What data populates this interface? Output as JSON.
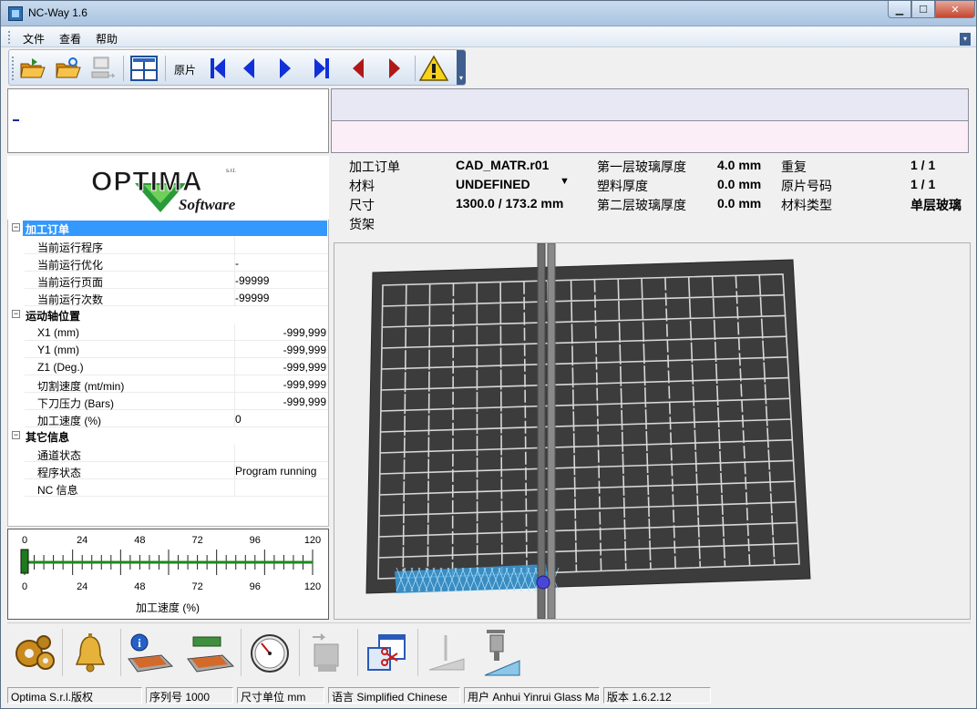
{
  "window": {
    "title": "NC-Way 1.6",
    "min_glyph": "▁",
    "max_glyph": "☐",
    "close_glyph": "✕"
  },
  "menu": {
    "items": [
      "文件",
      "查看",
      "帮助"
    ]
  },
  "toolbar": {
    "label": "原片",
    "buttons": [
      {
        "name": "open-folder-icon",
        "color": "#e8a51c"
      },
      {
        "name": "open-folder-refresh-icon",
        "color": "#e8a51c"
      },
      {
        "name": "computer-send-icon",
        "color": "#b0b0b0"
      },
      {
        "name": "grid-view-icon",
        "color": "#1f4e9c"
      },
      {
        "name": "first-icon",
        "color": "#1030d8"
      },
      {
        "name": "previous-icon",
        "color": "#1030d8"
      },
      {
        "name": "next-icon",
        "color": "#1030d8"
      },
      {
        "name": "last-icon",
        "color": "#1030d8"
      },
      {
        "name": "back-red-icon",
        "color": "#b01818"
      },
      {
        "name": "forward-red-icon",
        "color": "#b01818"
      },
      {
        "name": "warning-icon",
        "color": "#f7d21b"
      }
    ]
  },
  "logo": {
    "brand": "OPTIMA",
    "sub": "Software",
    "mark": "s.r.l."
  },
  "tree": {
    "groups": [
      {
        "label": "加工订单",
        "rows": [
          {
            "k": "当前运行程序",
            "v": ""
          },
          {
            "k": "当前运行优化",
            "v": "-"
          },
          {
            "k": "当前运行页面",
            "v": "-99999"
          },
          {
            "k": "当前运行次数",
            "v": "-99999"
          }
        ]
      },
      {
        "label": "运动轴位置",
        "rows": [
          {
            "k": "X1 (mm)",
            "v": "-999,999"
          },
          {
            "k": "Y1 (mm)",
            "v": "-999,999"
          },
          {
            "k": "Z1 (Deg.)",
            "v": "-999,999"
          },
          {
            "k": "切割速度 (mt/min)",
            "v": "-999,999"
          },
          {
            "k": "下刀压力 (Bars)",
            "v": "-999,999"
          },
          {
            "k": "加工速度 (%)",
            "v": "0"
          }
        ]
      },
      {
        "label": "其它信息",
        "rows": [
          {
            "k": "通道状态",
            "v": ""
          },
          {
            "k": "程序状态",
            "v": "Program running"
          },
          {
            "k": "NC 信息",
            "v": ""
          }
        ]
      }
    ]
  },
  "gauge": {
    "ticks": [
      "0",
      "24",
      "48",
      "72",
      "96",
      "120"
    ],
    "label": "加工速度 (%)",
    "value": 0,
    "max": 120
  },
  "info": {
    "order_label": "加工订单",
    "order_value": "CAD_MATR.r01",
    "material_label": "材料",
    "material_value": "UNDEFINED",
    "size_label": "尺寸",
    "size_value": "1300.0 / 173.2 mm",
    "rack_label": "货架",
    "layer1_label": "第一层玻璃厚度",
    "layer1_value": "4.0 mm",
    "plastic_label": "塑料厚度",
    "plastic_value": "0.0 mm",
    "layer2_label": "第二层玻璃厚度",
    "layer2_value": "0.0 mm",
    "repeat_label": "重复",
    "repeat_value": "1 / 1",
    "sheet_label": "原片号码",
    "sheet_value": "1 / 1",
    "mtype_label": "材料类型",
    "mtype_value": "单层玻璃"
  },
  "bottom_tools": [
    {
      "name": "gears-icon"
    },
    {
      "name": "bell-icon"
    },
    {
      "name": "machine-info-icon"
    },
    {
      "name": "machine-table-icon"
    },
    {
      "name": "pressure-gauge-icon"
    },
    {
      "name": "disabled-machine-icon"
    },
    {
      "name": "cut-window-icon"
    },
    {
      "name": "disabled-cutter-icon"
    },
    {
      "name": "cutting-head-icon"
    }
  ],
  "status": {
    "copyright": "Optima S.r.l.版权",
    "serial": "序列号 1000",
    "units": "尺寸单位 mm",
    "language": "语言 Simplified Chinese",
    "user": "用户 Anhui Yinrui Glass Ma",
    "version": "版本 1.6.2.12"
  }
}
